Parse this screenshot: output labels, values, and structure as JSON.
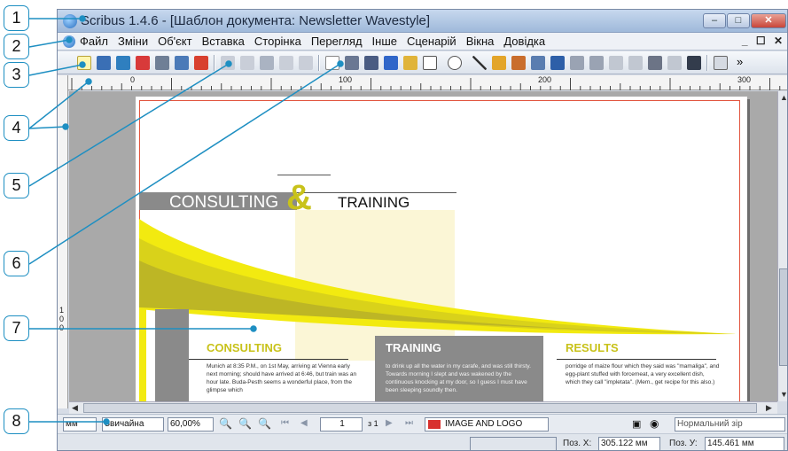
{
  "window": {
    "title": "Scribus 1.4.6 - [Шаблон документа: Newsletter Wavestyle]",
    "controls": [
      "–",
      "□",
      "✕"
    ]
  },
  "menu": {
    "items": [
      "Файл",
      "Зміни",
      "Об'єкт",
      "Вставка",
      "Сторінка",
      "Перегляд",
      "Інше",
      "Сценарій",
      "Вікна",
      "Довідка"
    ],
    "mdi_controls": "_ ☐ ✕"
  },
  "toolbar": {
    "icons": [
      "new-doc-icon",
      "open-icon",
      "save-icon",
      "close-doc-icon",
      "print-icon",
      "preflight-icon",
      "pdf-icon",
      "undo-icon",
      "redo-icon",
      "cut-icon",
      "copy-icon",
      "paste-icon",
      "select-icon",
      "text-frame-icon",
      "image-frame-icon",
      "render-frame-icon",
      "table-icon",
      "shape-icon",
      "polygon-icon",
      "line-icon",
      "bezier-icon",
      "freehand-icon",
      "rotate-icon",
      "zoom-icon",
      "edit-text-icon",
      "story-editor-icon",
      "link-frames-icon",
      "unlink-frames-icon",
      "measure-icon",
      "copy-properties-icon",
      "eyedropper-icon",
      "pdf-button-icon"
    ],
    "overflow": "»"
  },
  "rulers": {
    "top_labels": [
      "0",
      "100",
      "200",
      "300"
    ],
    "left_labels": [
      "1",
      "0",
      "0"
    ]
  },
  "document": {
    "header_left": "CONSULTING",
    "header_amp": "&",
    "header_right": "TRAINING",
    "columns": [
      {
        "heading": "CONSULTING",
        "text": "Munich at 8:35 P.M., on 1st May, arriving at Vienna early next morning; should have arrived at 6:46, but train was an hour late. Buda-Pesth seems a wonderful place, from the glimpse which"
      },
      {
        "heading": "TRAINING",
        "text": "to drink up all the water in my carafe, and was still thirsty. Towards morning I slept and was wakened by the continuous knocking at my door, so I guess I must have been sleeping soundly then."
      },
      {
        "heading": "RESULTS",
        "text": "porridge of maize flour which they said was \"mamaliga\", and egg-plant stuffed with forcemeat, a very excellent dish, which they call \"impletata\". (Mem., get recipe for this also.)"
      }
    ]
  },
  "statusbar": {
    "unit_select": "мм",
    "style_select": "Звичайна",
    "zoom": "60,00%",
    "page_number": "1",
    "page_of": "з 1",
    "layer": "IMAGE AND LOGO",
    "view_mode": "Нормальний зір",
    "pos_x_label": "Поз. X:",
    "pos_x": "305.122 мм",
    "pos_y_label": "Поз. У:",
    "pos_y": "145.461 мм"
  },
  "callouts": [
    "1",
    "2",
    "3",
    "4",
    "5",
    "6",
    "7",
    "8"
  ],
  "colors": {
    "callout_blue": "#1e8fc2",
    "margin_red": "#e2553e",
    "accent_yellow": "#d8d41b",
    "header_gray": "#8a8a8a"
  }
}
